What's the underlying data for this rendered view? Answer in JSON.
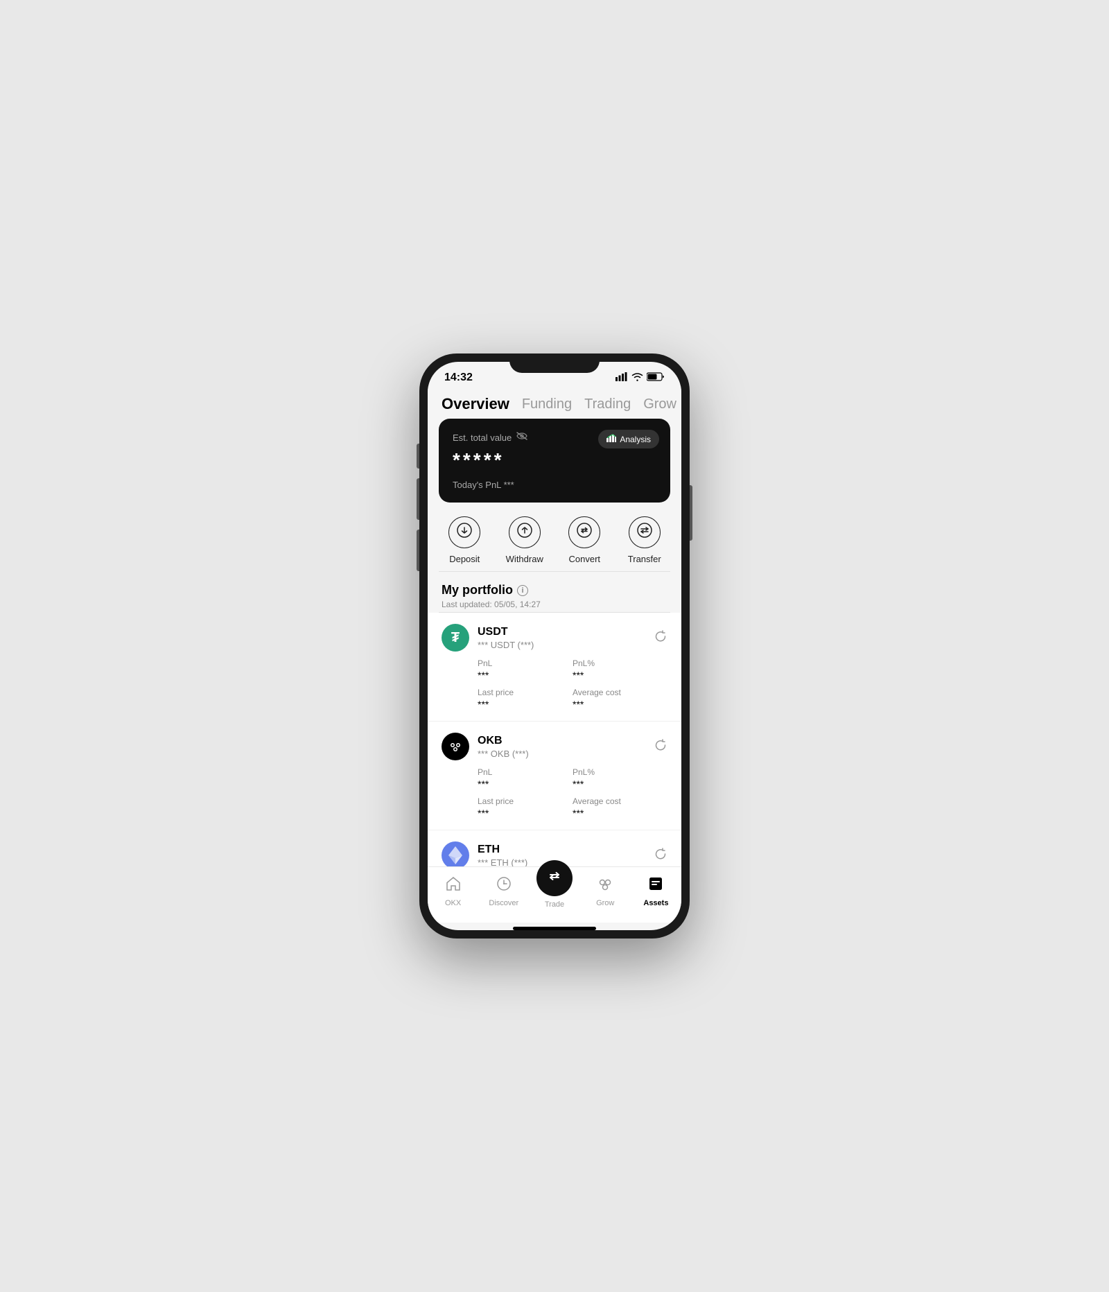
{
  "status_bar": {
    "time": "14:32",
    "signal": "▲▲▲",
    "wifi": "wifi",
    "battery": "41"
  },
  "nav": {
    "tabs": [
      {
        "label": "Overview",
        "active": true
      },
      {
        "label": "Funding",
        "active": false
      },
      {
        "label": "Trading",
        "active": false
      },
      {
        "label": "Grow",
        "active": false
      }
    ]
  },
  "value_card": {
    "label": "Est. total value",
    "value": "*****",
    "pnl_label": "Today's PnL",
    "pnl_value": "***",
    "analysis_label": "Analysis"
  },
  "actions": [
    {
      "id": "deposit",
      "label": "Deposit",
      "icon": "⬇"
    },
    {
      "id": "withdraw",
      "label": "Withdraw",
      "icon": "⬆"
    },
    {
      "id": "convert",
      "label": "Convert",
      "icon": "⇅"
    },
    {
      "id": "transfer",
      "label": "Transfer",
      "icon": "⇌"
    }
  ],
  "portfolio": {
    "title": "My portfolio",
    "subtitle": "Last updated: 05/05, 14:27",
    "assets": [
      {
        "symbol": "USDT",
        "type": "usdt",
        "amount": "*** USDT (***)",
        "pnl": "***",
        "pnl_pct": "***",
        "last_price": "***",
        "avg_cost": "***"
      },
      {
        "symbol": "OKB",
        "type": "okb",
        "amount": "*** OKB (***)",
        "pnl": "***",
        "pnl_pct": "***",
        "last_price": "***",
        "avg_cost": "***"
      },
      {
        "symbol": "ETH",
        "type": "eth",
        "amount": "*** ETH (***)",
        "pnl": "***",
        "pnl_pct": "***",
        "last_price": "***",
        "avg_cost": "***"
      }
    ]
  },
  "bottom_nav": {
    "items": [
      {
        "id": "okx",
        "label": "OKX",
        "active": false
      },
      {
        "id": "discover",
        "label": "Discover",
        "active": false
      },
      {
        "id": "trade",
        "label": "Trade",
        "active": false,
        "is_fab": true
      },
      {
        "id": "grow",
        "label": "Grow",
        "active": false
      },
      {
        "id": "assets",
        "label": "Assets",
        "active": true
      }
    ]
  },
  "labels": {
    "pnl": "PnL",
    "pnl_pct": "PnL%",
    "last_price": "Last price",
    "avg_cost": "Average cost",
    "hidden_value": "*****"
  }
}
